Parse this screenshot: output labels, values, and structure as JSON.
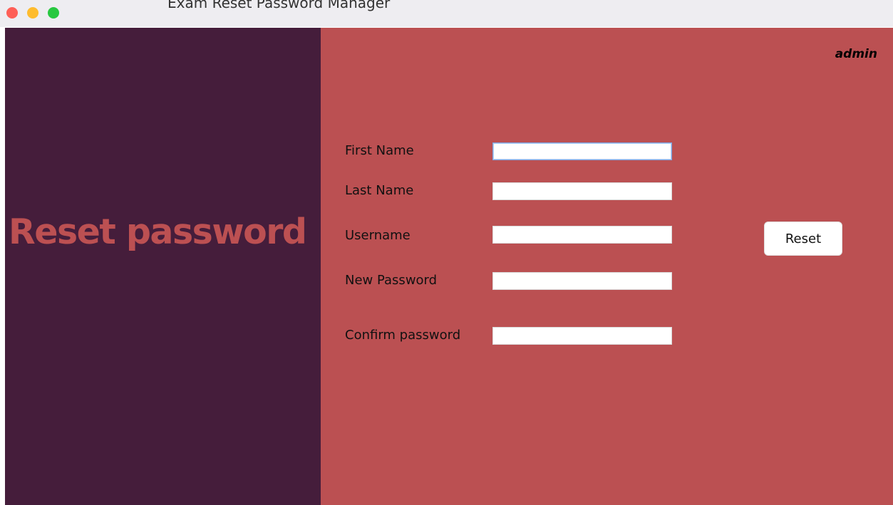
{
  "window": {
    "title": "Exam Reset Password Manager"
  },
  "sidebar": {
    "heading": "Reset password"
  },
  "header": {
    "user": "admin"
  },
  "form": {
    "fields": [
      {
        "label": "First Name",
        "value": ""
      },
      {
        "label": "Last Name",
        "value": ""
      },
      {
        "label": "Username",
        "value": ""
      },
      {
        "label": "New Password",
        "value": ""
      },
      {
        "label": "Confirm password",
        "value": ""
      }
    ],
    "reset_label": "Reset"
  },
  "colors": {
    "left_panel": "#451d3b",
    "right_panel": "#bb5052",
    "heading_accent": "#bc5052"
  }
}
